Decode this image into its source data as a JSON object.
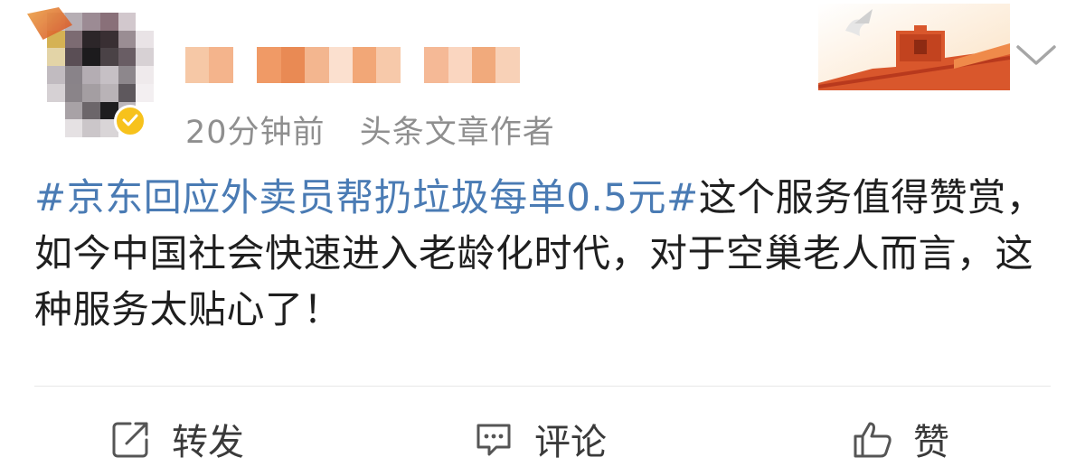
{
  "header": {
    "username": "",
    "timestamp": "20分钟前",
    "source": "头条文章作者",
    "verified_badge_color": "#f7c21c"
  },
  "post": {
    "topic": "#京东回应外卖员帮扔垃圾每单0.5元#",
    "text": "这个服务值得赞赏，如今中国社会快速进入老龄化时代，对于空巢老人而言，这种服务太贴心了！"
  },
  "actions": {
    "repost_label": "转发",
    "comment_label": "评论",
    "like_label": "赞"
  },
  "icons": {
    "repost": "repost-icon",
    "comment": "comment-icon",
    "like": "thumbs-up-icon",
    "more": "chevron-down-icon"
  },
  "colors": {
    "topic_link": "#4a7bb4",
    "meta_text": "#8f8f8f"
  }
}
